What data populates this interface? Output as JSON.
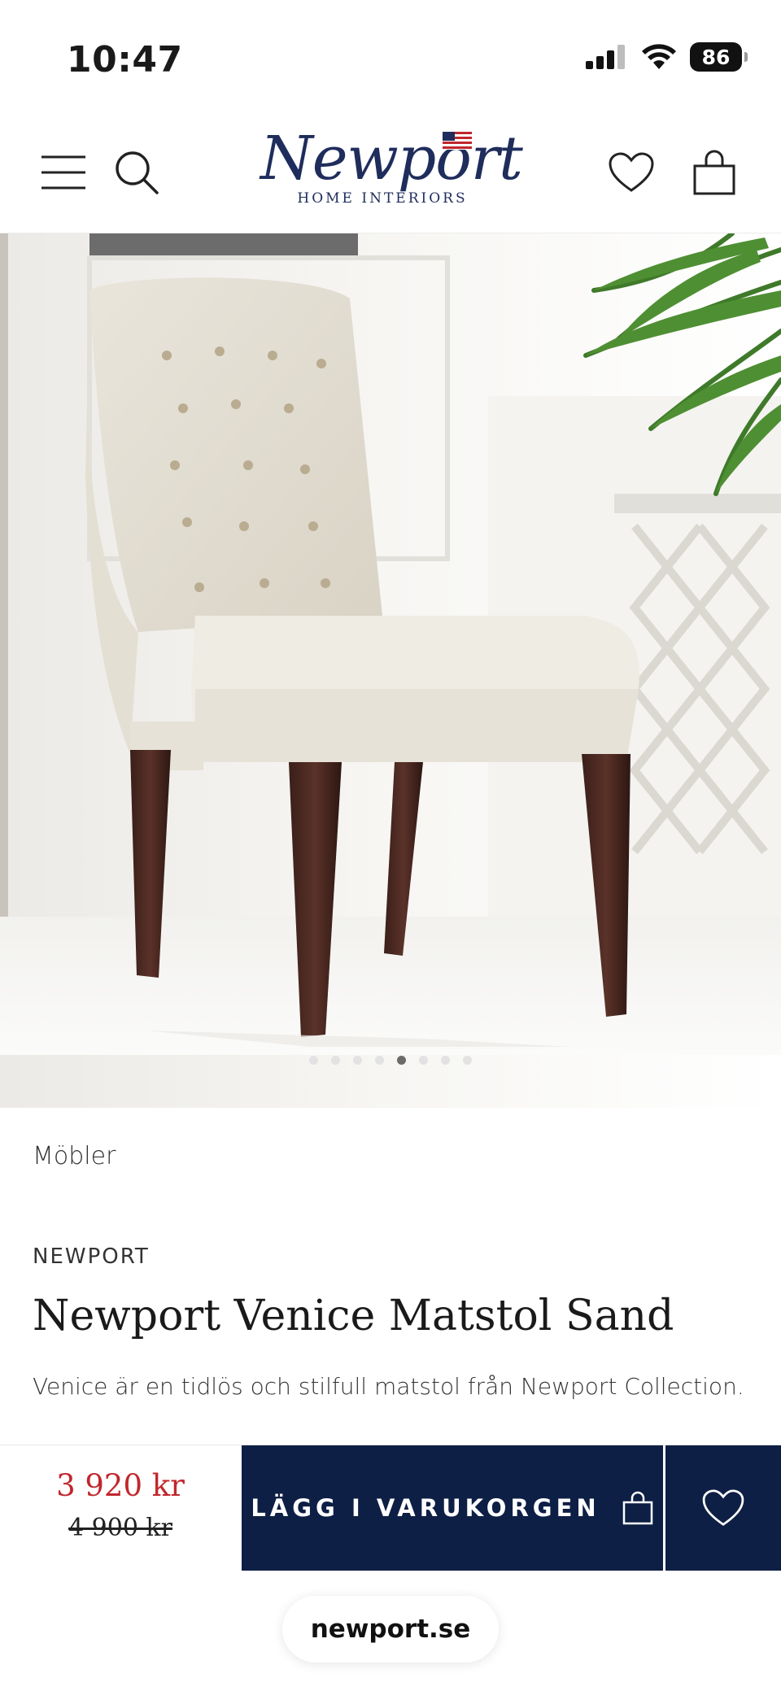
{
  "status_bar": {
    "time": "10:47",
    "battery": "86"
  },
  "header": {
    "logo_script": "Newport",
    "logo_subtitle": "HOME INTERIORS",
    "icons": [
      "menu-icon",
      "search-icon",
      "heart-icon",
      "shopping-bag-icon"
    ]
  },
  "gallery": {
    "image_count": 8,
    "active_index": 4
  },
  "product": {
    "category": "Möbler",
    "brand": "NEWPORT",
    "title": "Newport Venice Matstol Sand",
    "description": "Venice är en tidlös och stilfull matstol från Newport Collection."
  },
  "buy_bar": {
    "price_now": "3 920 kr",
    "price_old": "4 900 kr",
    "add_to_cart_label": "LÄGG I VARUKORGEN",
    "accent_color": "#0e1f45",
    "sale_color": "#c0272d"
  },
  "browser": {
    "url": "newport.se"
  }
}
